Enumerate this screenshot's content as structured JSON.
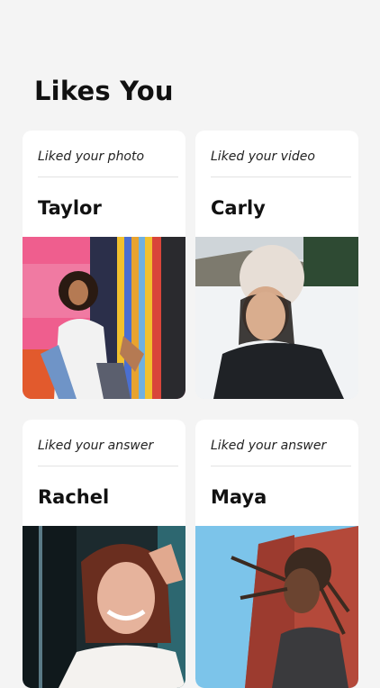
{
  "header": {
    "title": "Likes You"
  },
  "cards": [
    {
      "reason": "Liked your photo",
      "name": "Taylor"
    },
    {
      "reason": "Liked your video",
      "name": "Carly"
    },
    {
      "reason": "Liked your answer",
      "name": "Rachel"
    },
    {
      "reason": "Liked your answer",
      "name": "Maya"
    }
  ]
}
